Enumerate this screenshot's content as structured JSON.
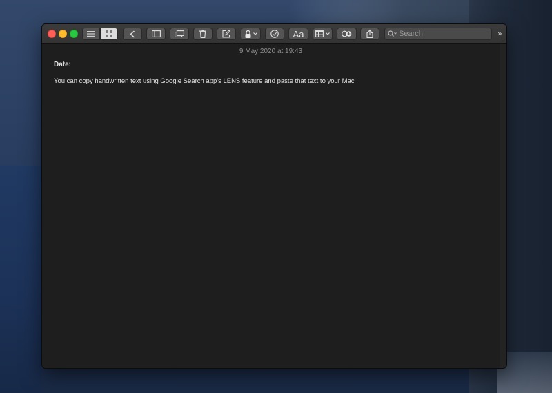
{
  "toolbar": {
    "buttons": [
      {
        "name": "list-view",
        "icon": "list-icon"
      },
      {
        "name": "gallery-view",
        "icon": "grid-icon"
      },
      {
        "name": "back",
        "icon": "chevron-left-icon"
      },
      {
        "name": "sidebar",
        "icon": "sidebar-icon"
      },
      {
        "name": "attachments",
        "icon": "attachments-icon"
      },
      {
        "name": "delete",
        "icon": "trash-icon"
      },
      {
        "name": "new-note",
        "icon": "compose-icon"
      },
      {
        "name": "lock",
        "icon": "lock-icon"
      },
      {
        "name": "checklist",
        "icon": "checklist-icon"
      },
      {
        "name": "format",
        "icon": "format-text-icon"
      },
      {
        "name": "table",
        "icon": "table-icon"
      },
      {
        "name": "collaborate",
        "icon": "add-people-icon"
      },
      {
        "name": "share",
        "icon": "share-icon"
      }
    ],
    "format_label": "Aa",
    "more_label": "»"
  },
  "search": {
    "placeholder": "Search",
    "value": ""
  },
  "note": {
    "date": "9 May 2020 at 19:43",
    "heading": "Date:",
    "body": "You can copy handwritten text using Google Search app's LENS feature and paste that text to your Mac"
  },
  "colors": {
    "close": "#ff5f57",
    "minimize": "#febc2e",
    "maximize": "#28c840",
    "note_background": "#1e1e1e",
    "toolbar_background": "#383838",
    "text": "#e4e4e4",
    "date_text": "#8e8e8e"
  }
}
